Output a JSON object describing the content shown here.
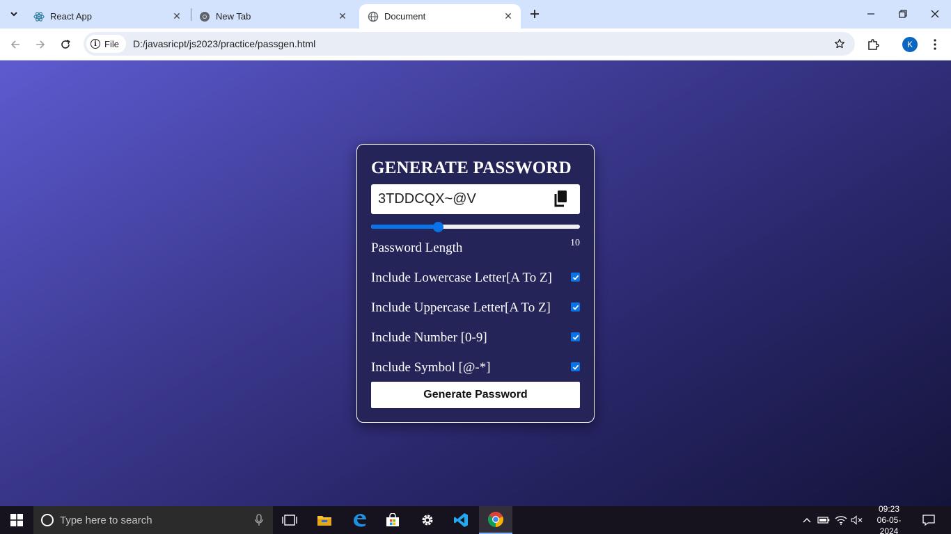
{
  "browser": {
    "tabs": [
      {
        "title": "React App",
        "favicon": "react-icon",
        "active": false
      },
      {
        "title": "New Tab",
        "favicon": "chrome-icon",
        "active": false
      },
      {
        "title": "Document",
        "favicon": "globe-icon",
        "active": true
      }
    ],
    "site_chip_label": "File",
    "url": "D:/javasricpt/js2023/practice/passgen.html",
    "profile_initial": "K"
  },
  "app": {
    "title": "GENERATE PASSWORD",
    "password": "3TDDCQX~@V",
    "length_label": "Password Length",
    "length_value": "10",
    "slider_fraction": 0.32,
    "options": [
      {
        "label": "Include Lowercase Letter[A To Z]",
        "checked": true
      },
      {
        "label": "Include Uppercase Letter[A To Z]",
        "checked": true
      },
      {
        "label": "Include Number [0-9]",
        "checked": true
      },
      {
        "label": "Include Symbol [@-*]",
        "checked": true
      }
    ],
    "generate_label": "Generate Password",
    "colors": {
      "accent": "#0b73e8",
      "card_bg": "#252458"
    }
  },
  "taskbar": {
    "search_placeholder": "Type here to search",
    "time": "09:23",
    "date": "06-05-2024",
    "apps": [
      "task-view-icon",
      "file-explorer-icon",
      "edge-icon",
      "store-icon",
      "settings-icon",
      "vscode-icon",
      "chrome-icon"
    ]
  }
}
